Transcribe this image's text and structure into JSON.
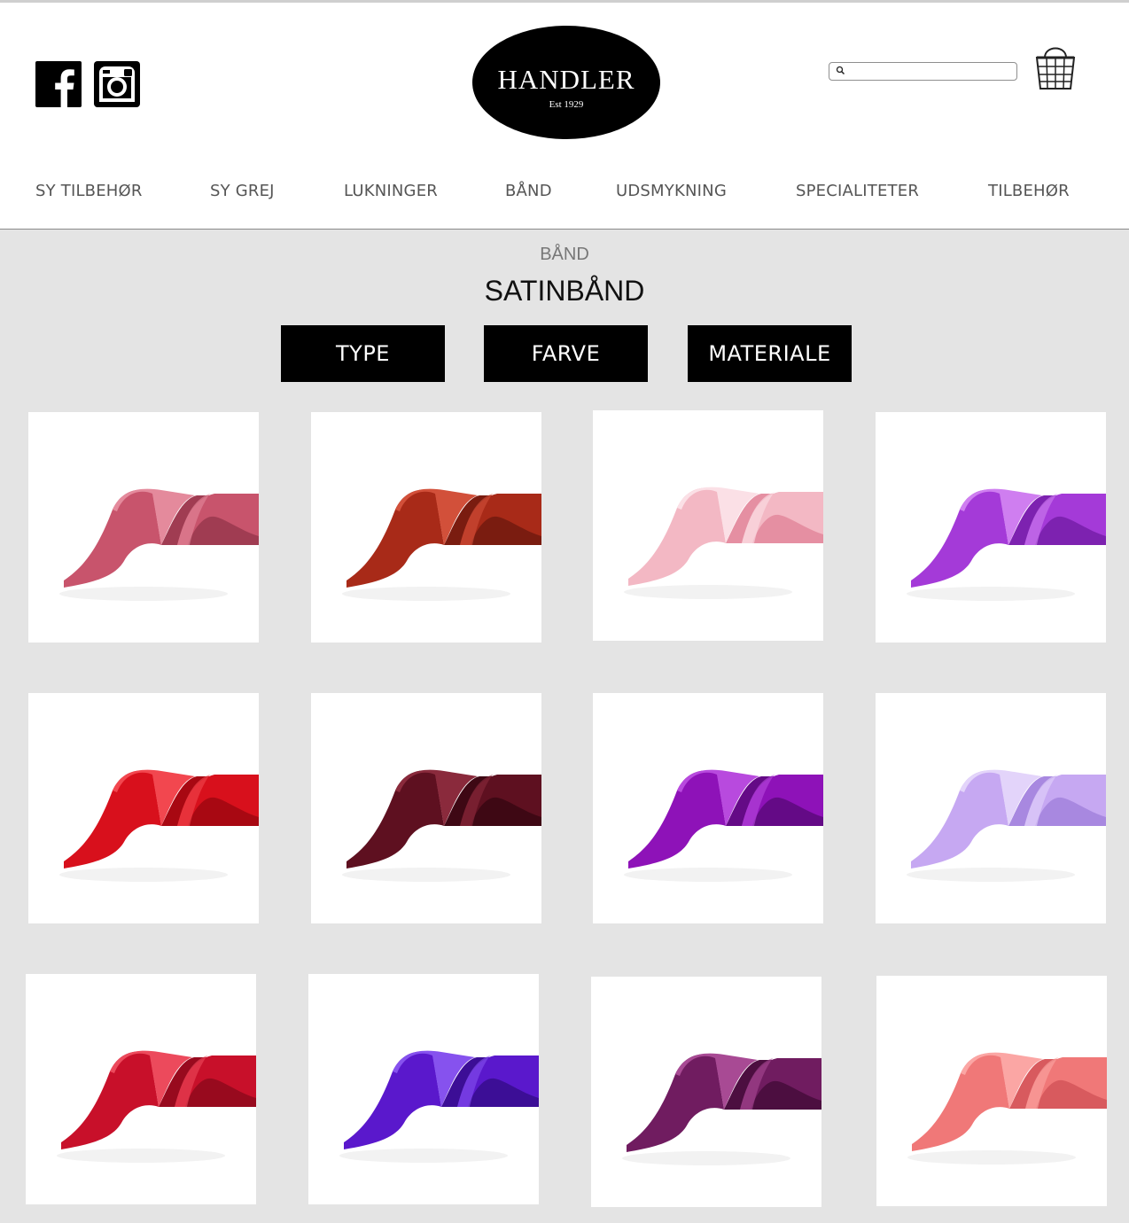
{
  "header": {
    "logo": {
      "name": "HANDLER",
      "established": "Est 1929"
    },
    "social_icons": [
      "facebook-icon",
      "instagram-icon"
    ],
    "search": {
      "value": "",
      "placeholder": ""
    },
    "cart_icon": "basket-icon"
  },
  "nav": {
    "items": [
      {
        "label": "SY TILBEHØR"
      },
      {
        "label": "SY GREJ"
      },
      {
        "label": "LUKNINGER"
      },
      {
        "label": "BÅND"
      },
      {
        "label": "UDSMYKNING"
      },
      {
        "label": "SPECIALITETER"
      },
      {
        "label": "TILBEHØR"
      }
    ]
  },
  "page": {
    "breadcrumb": "BÅND",
    "title": "SATINBÅND"
  },
  "filters": [
    {
      "label": "TYPE"
    },
    {
      "label": "FARVE"
    },
    {
      "label": "MATERIALE"
    }
  ],
  "products": [
    {
      "color": "#c8546c",
      "shade": "#a03c52",
      "light": "#e48a9c"
    },
    {
      "color": "#a82a18",
      "shade": "#7a1c10",
      "light": "#d2503a"
    },
    {
      "color": "#f3b8c4",
      "shade": "#e58fa2",
      "light": "#fbe0e6"
    },
    {
      "color": "#a43ad8",
      "shade": "#7d22b0",
      "light": "#cf7ef0"
    },
    {
      "color": "#d8101c",
      "shade": "#a80812",
      "light": "#f2474f"
    },
    {
      "color": "#5e1020",
      "shade": "#3e0814",
      "light": "#8a2a3c"
    },
    {
      "color": "#8e12b8",
      "shade": "#640a86",
      "light": "#b84ade"
    },
    {
      "color": "#c6a8f2",
      "shade": "#a888e0",
      "light": "#e3d4fa"
    },
    {
      "color": "#c8102a",
      "shade": "#980a1e",
      "light": "#ec4a5c"
    },
    {
      "color": "#5a18cc",
      "shade": "#3c0e96",
      "light": "#8652ee"
    },
    {
      "color": "#701c60",
      "shade": "#4c0e40",
      "light": "#a84a94"
    },
    {
      "color": "#f07878",
      "shade": "#d85a5e",
      "light": "#fba6a4"
    }
  ]
}
